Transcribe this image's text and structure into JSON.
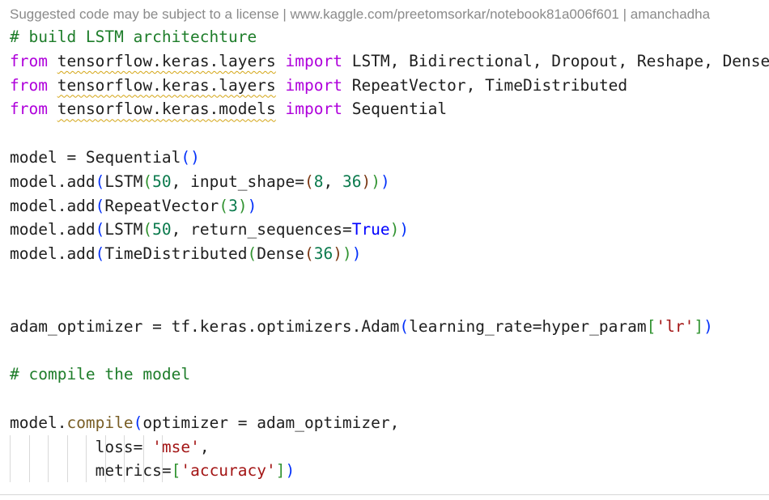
{
  "license_note": "Suggested code may be subject to a license | www.kaggle.com/preetomsorkar/notebook81a006f601 | amanchadha",
  "code": {
    "comment_build": "# build LSTM architechture",
    "kw_from": "from",
    "kw_import": "import",
    "mod_layers": "tensorflow.keras.layers",
    "mod_models": "tensorflow.keras.models",
    "import1_names": "LSTM, Bidirectional, Dropout, Reshape, Dense",
    "import2_names": "RepeatVector, TimeDistributed",
    "import3_names": "Sequential",
    "model_assign": "model = ",
    "sequential": "Sequential",
    "model_add": "model.add",
    "lstm": "LSTM",
    "n50": "50",
    "input_shape_kw": "input_shape=",
    "n8": "8",
    "n36": "36",
    "comma": ", ",
    "repeat_vector": "RepeatVector",
    "n3": "3",
    "return_sequences_kw": "return_sequences=",
    "true_const": "True",
    "time_distributed": "TimeDistributed",
    "dense": "Dense",
    "adam_assign": "adam_optimizer = tf.keras.optimizers.Adam",
    "lr_kw": "learning_rate=hyper_param",
    "lr_str": "'lr'",
    "comment_compile": "# compile the model",
    "model_prefix": "model.",
    "compile": "compile",
    "optimizer_arg": "optimizer = adam_optimizer,",
    "loss_kw": "loss= ",
    "mse_str": "'mse'",
    "metrics_kw": "metrics=",
    "accuracy_str": "'accuracy'"
  },
  "colors": {
    "comment": "#1e7d2a",
    "keyword": "#af00db",
    "number": "#0b7a4d",
    "string": "#a31515",
    "constant": "#0000ff",
    "method": "#795e26",
    "bracket_level1": "#0431fa",
    "bracket_level2": "#319331",
    "bracket_level3": "#7b3814",
    "license_text": "#8a8a8a"
  }
}
